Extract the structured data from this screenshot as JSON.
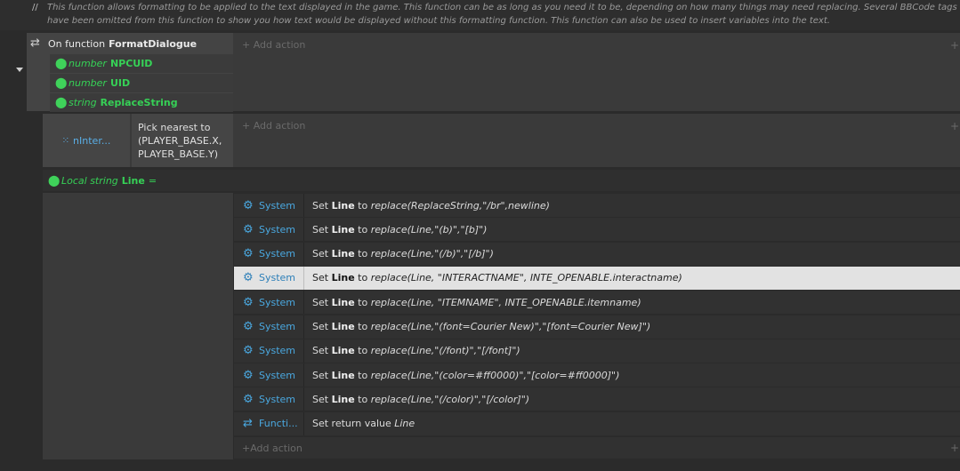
{
  "comment": {
    "prefix": "//",
    "text": "This function allows formatting to be applied to the text displayed in the game. This function can be as long as you need it to be, depending on how many things may need replacing. Several BBCode tags have been omitted from this function to show you how text would be displayed without this formatting function. This function can also be used to insert variables into the text."
  },
  "function_event": {
    "prefix": "On function",
    "name": "FormatDialogue",
    "params": [
      {
        "type": "number",
        "name": "NPCUID"
      },
      {
        "type": "number",
        "name": "UID"
      },
      {
        "type": "string",
        "name": "ReplaceString"
      }
    ],
    "add_action": "Add action"
  },
  "sub_event": {
    "object": "nInter...",
    "condition_line1": "Pick nearest to",
    "condition_line2": "(PLAYER_BASE.X,",
    "condition_line3": "PLAYER_BASE.Y)",
    "add_action": "Add action"
  },
  "local_var": {
    "kind": "Local string",
    "name": "Line",
    "suffix": "="
  },
  "actions": [
    {
      "object": "System",
      "icon": "gear-icon",
      "set": "Set",
      "var": "Line",
      "to": "to",
      "expr": "replace(ReplaceString,\"/br\",newline)",
      "selected": false
    },
    {
      "object": "System",
      "icon": "gear-icon",
      "set": "Set",
      "var": "Line",
      "to": "to",
      "expr": "replace(Line,\"(b)\",\"[b]\")",
      "selected": false
    },
    {
      "object": "System",
      "icon": "gear-icon",
      "set": "Set",
      "var": "Line",
      "to": "to",
      "expr": "replace(Line,\"(/b)\",\"[/b]\")",
      "selected": false
    },
    {
      "object": "System",
      "icon": "gear-icon",
      "set": "Set",
      "var": "Line",
      "to": "to",
      "expr": "replace(Line, \"INTERACTNAME\", INTE_OPENABLE.interactname)",
      "selected": true
    },
    {
      "object": "System",
      "icon": "gear-icon",
      "set": "Set",
      "var": "Line",
      "to": "to",
      "expr": "replace(Line, \"ITEMNAME\", INTE_OPENABLE.itemname)",
      "selected": false
    },
    {
      "object": "System",
      "icon": "gear-icon",
      "set": "Set",
      "var": "Line",
      "to": "to",
      "expr": "replace(Line,\"(font=Courier New)\",\"[font=Courier New]\")",
      "selected": false
    },
    {
      "object": "System",
      "icon": "gear-icon",
      "set": "Set",
      "var": "Line",
      "to": "to",
      "expr": "replace(Line,\"(/font)\",\"[/font]\")",
      "selected": false
    },
    {
      "object": "System",
      "icon": "gear-icon",
      "set": "Set",
      "var": "Line",
      "to": "to",
      "expr": "replace(Line,\"(color=#ff0000)\",\"[color=#ff0000]\")",
      "selected": false
    },
    {
      "object": "System",
      "icon": "gear-icon",
      "set": "Set",
      "var": "Line",
      "to": "to",
      "expr": "replace(Line,\"(/color)\",\"[/color]\")",
      "selected": false
    },
    {
      "object": "Functi...",
      "icon": "loop-icon",
      "set": "Set return value",
      "var": "",
      "to": "",
      "expr": "Line",
      "selected": false
    }
  ],
  "bottom_add_action": "Add action",
  "colors": {
    "param_green": "#36d156",
    "object_blue": "#4aa8e0",
    "selected_row": "#e2e2e2"
  }
}
